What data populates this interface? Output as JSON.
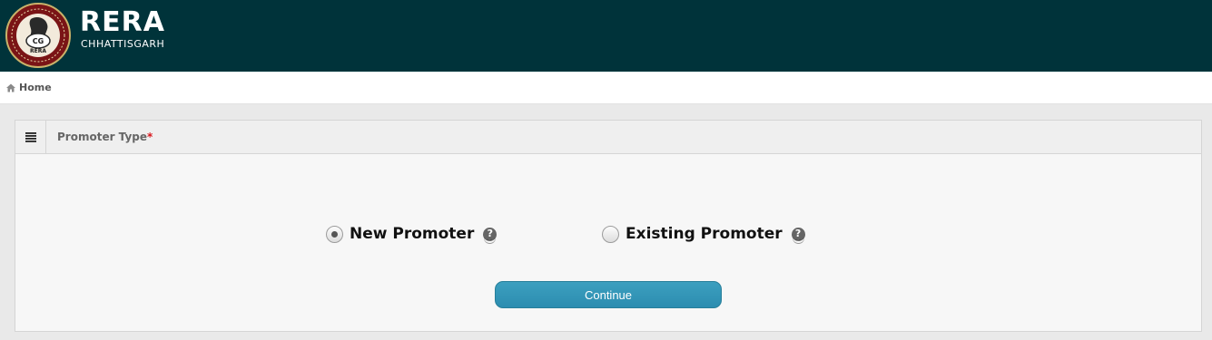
{
  "header": {
    "brand_title": "RERA",
    "brand_subtitle": "CHHATTISGARH",
    "logo_text": "CG RERA",
    "colors": {
      "background": "#00333a",
      "text": "#ffffff"
    }
  },
  "breadcrumb": {
    "icon": "home-icon",
    "label": "Home"
  },
  "panel": {
    "menu_icon": "list-icon",
    "title": "Promoter Type",
    "required_mark": "*",
    "options": [
      {
        "label": "New Promoter",
        "selected": true,
        "help_icon": "question-icon",
        "help_glyph": "?"
      },
      {
        "label": "Existing Promoter",
        "selected": false,
        "help_icon": "question-icon",
        "help_glyph": "?"
      }
    ],
    "continue_label": "Continue",
    "colors": {
      "button": "#2e93b6",
      "required": "#d9161c"
    }
  }
}
